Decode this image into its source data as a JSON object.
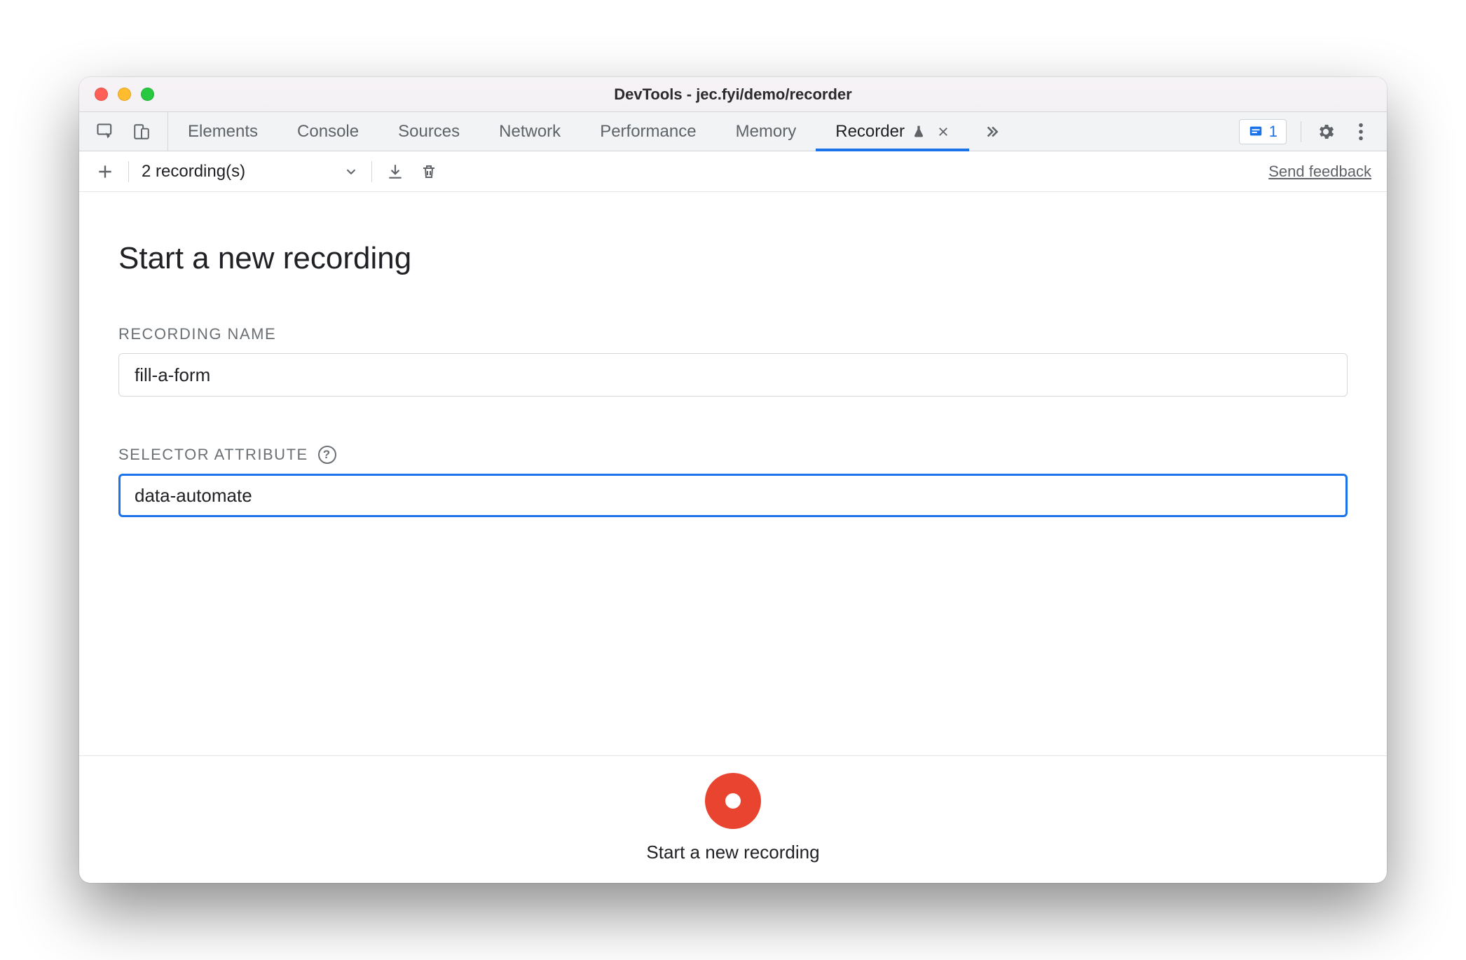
{
  "window": {
    "title": "DevTools - jec.fyi/demo/recorder"
  },
  "tabs": {
    "items": [
      {
        "label": "Elements"
      },
      {
        "label": "Console"
      },
      {
        "label": "Sources"
      },
      {
        "label": "Network"
      },
      {
        "label": "Performance"
      },
      {
        "label": "Memory"
      },
      {
        "label": "Recorder",
        "active": true,
        "experimental": true,
        "closable": true
      }
    ],
    "issues_count": "1"
  },
  "subtoolbar": {
    "dropdown_label": "2 recording(s)",
    "feedback_label": "Send feedback"
  },
  "main": {
    "heading": "Start a new recording",
    "recording_name_label": "RECORDING NAME",
    "recording_name_value": "fill-a-form",
    "selector_attr_label": "SELECTOR ATTRIBUTE",
    "selector_attr_value": "data-automate"
  },
  "footer": {
    "button_label": "Start a new recording"
  }
}
